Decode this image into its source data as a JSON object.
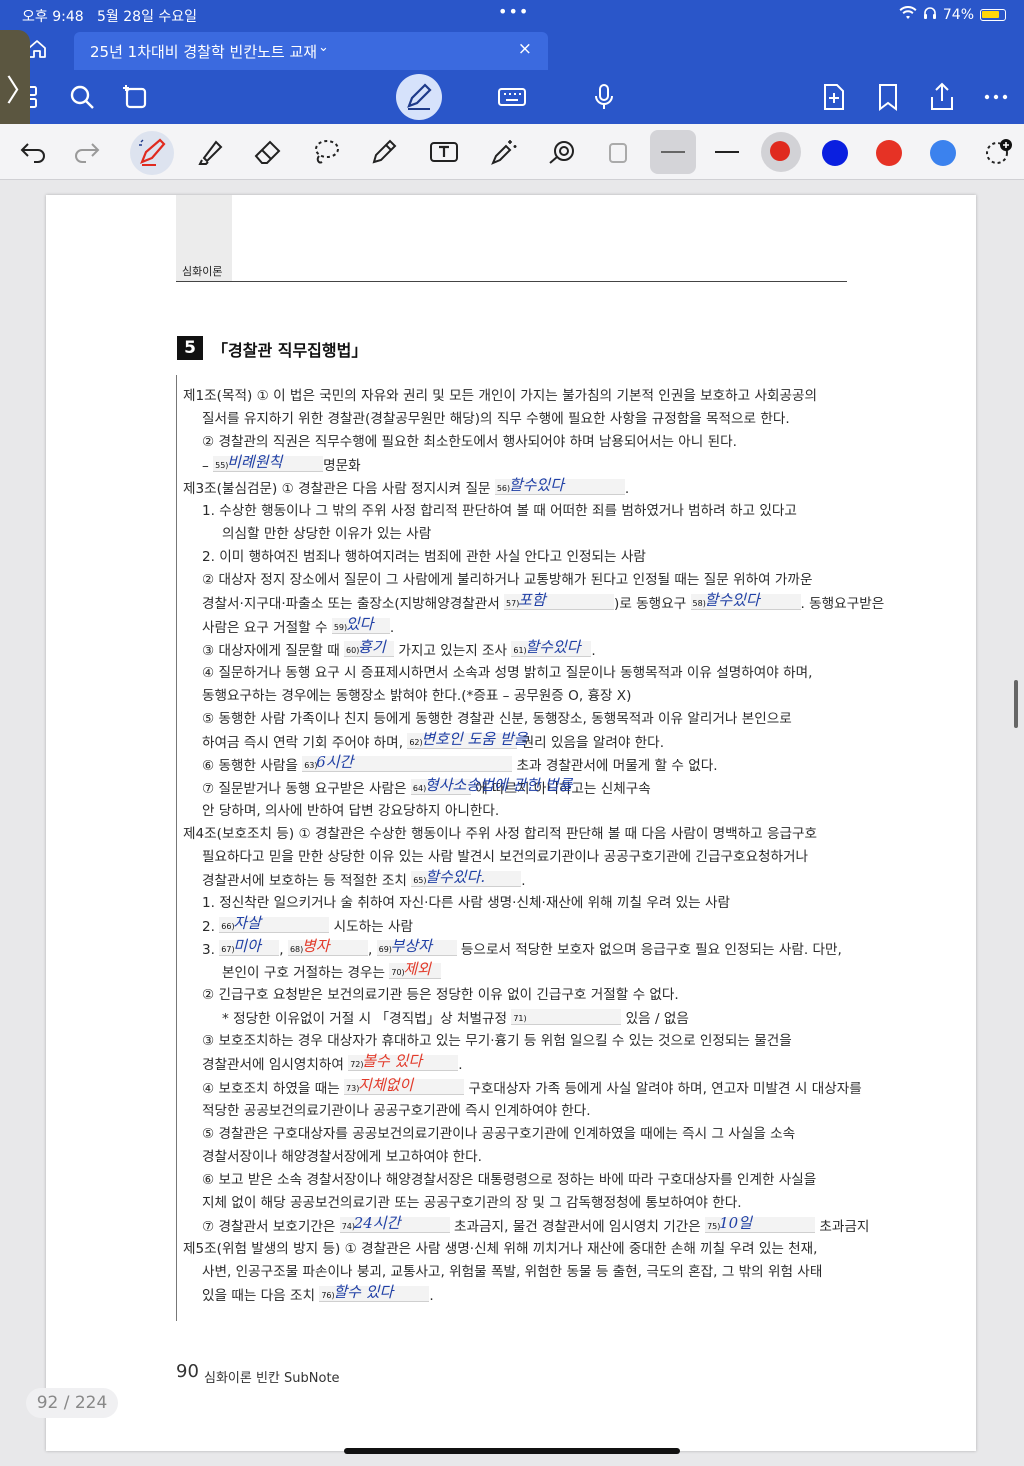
{
  "status": {
    "time": "오후 9:48",
    "date": "5월 28일 수요일",
    "battery": "74%"
  },
  "tab": {
    "title": "25년 1차대비 경찰학 빈칸노트 교재"
  },
  "colors": {
    "toolbar": "#2a56c9",
    "swatches": [
      "#e02a1e",
      "#0a1fe0",
      "#e63225",
      "#3b82ee"
    ]
  },
  "page": {
    "running_head": "심화이론",
    "section_number": "5",
    "section_title": "「경찰관 직무집행법」",
    "lines": [
      {
        "t": "제1조(목적) ① 이 법은 국민의 자유와 권리 및 모든 개인이 가지는 불가침의 기본적 인권을 보호하고 사회공공의"
      },
      {
        "t": "질서를 유지하기 위한 경찰관(경찰공무원만 해당)의 직무 수행에 필요한 사항을 규정함을 목적으로 한다."
      },
      {
        "t": "② 경찰관의 직권은 직무수행에 필요한 최소한도에서 행사되어야 하며 남용되어서는 아니 된다."
      },
      {
        "pre": "– ",
        "n": "55)",
        "hw": "비례원칙",
        "post": "명문화"
      },
      {
        "pre": "제3조(불심검문) ① 경찰관은 다음 사람 정지시켜 질문 ",
        "n": "56)",
        "hw": "할수있다",
        "post": "."
      },
      {
        "t": "1.  수상한 행동이나 그 밖의 주위 사정 합리적 판단하여 볼 때 어떠한 죄를 범하였거나 범하려 하고 있다고"
      },
      {
        "t": "의심할 만한 상당한 이유가 있는 사람"
      },
      {
        "t": "2.  이미 행하여진 범죄나 행하여지려는 범죄에 관한 사실 안다고 인정되는 사람"
      },
      {
        "t": "② 대상자 정지 장소에서 질문이 그 사람에게 불리하거나 교통방해가 된다고 인정될 때는 질문 위하여 가까운"
      },
      {
        "pre": "경찰서·지구대·파출소 또는 출장소(지방해양경찰관서 ",
        "n": "57)",
        "hw": "포함",
        "mid": ")로 동행요구 ",
        "n2": "58)",
        "hw2": "할수있다",
        "post": ". 동행요구받은"
      },
      {
        "pre": "사람은 요구 거절할 수 ",
        "n": "59)",
        "hw": "있다",
        "post": "."
      },
      {
        "pre": "③ 대상자에게 질문할 때 ",
        "n": "60)",
        "hw": "흉기",
        "mid": " 가지고 있는지 조사 ",
        "n2": "61)",
        "hw2": "할수있다",
        "post": "."
      },
      {
        "t": "④ 질문하거나 동행 요구 시 증표제시하면서 소속과 성명 밝히고 질문이나 동행목적과 이유 설명하여야 하며,"
      },
      {
        "t": "동행요구하는 경우에는 동행장소 밝혀야 한다.(*증표 – 공무원증 O, 흉장 X)"
      },
      {
        "t": "⑤ 동행한 사람 가족이나 친지 등에게 동행한 경찰관 신분, 동행장소, 동행목적과 이유 알리거나 본인으로"
      },
      {
        "pre": "하여금 즉시 연락 기회 주어야 하며, ",
        "n": "62)",
        "hw": "변호인 도움 받을",
        "post": " 권리 있음을 알려야 한다."
      },
      {
        "pre": "⑥ 동행한 사람을 ",
        "n": "63)",
        "hw": "6시간",
        "post": " 초과 경찰관서에 머물게 할 수 없다."
      },
      {
        "pre": "⑦ 질문받거나 동행 요구받은 사람은 ",
        "n": "64)",
        "hw": "형사소송법에 관한 법률",
        "post": " 에 따르지 아니하고는 신체구속"
      },
      {
        "t": "안 당하며, 의사에 반하여 답변 강요당하지 아니한다."
      },
      {
        "t": "제4조(보호조치 등) ① 경찰관은 수상한 행동이나 주위 사정 합리적 판단해 볼 때 다음 사람이 명백하고 응급구호"
      },
      {
        "t": "필요하다고 믿을 만한 상당한 이유 있는 사람 발견시 보건의료기관이나 공공구호기관에 긴급구호요청하거나"
      },
      {
        "pre": "경찰관서에 보호하는 등 적절한 조치 ",
        "n": "65)",
        "hw": "할수있다.",
        "post": "."
      },
      {
        "t": "1.  정신착란 일으키거나 술 취하여 자신·다른 사람 생명·신체·재산에 위해 끼칠 우려 있는 사람"
      },
      {
        "pre": "2.  ",
        "n": "66)",
        "hw": "자살",
        "post": " 시도하는 사람"
      },
      {
        "pre": "3.  ",
        "n": "67)",
        "hw": "미아",
        "mid": ", ",
        "n2": "68)",
        "hw2": "병자",
        "mid2": ", ",
        "n3": "69)",
        "hw3": "부상자",
        "post": " 등으로서 적당한 보호자 없으며 응급구호 필요 인정되는 사람. 다만,"
      },
      {
        "pre": "본인이 구호 거절하는 경우는 ",
        "n": "70)",
        "hw": "제외",
        "post": ""
      },
      {
        "t": "② 긴급구호 요청받은 보건의료기관 등은 정당한 이유 없이 긴급구호 거절할 수 없다."
      },
      {
        "pre": "* 정당한 이유없이 거절 시 「경직법」상 처벌규정 ",
        "n": "71)",
        "hw": "",
        "post": " 있음 / 없음"
      },
      {
        "t": "③ 보호조치하는 경우 대상자가 휴대하고 있는 무기·흉기 등 위험 일으킬 수 있는 것으로 인정되는 물건을"
      },
      {
        "pre": "경찰관서에 임시영치하여 ",
        "n": "72)",
        "hw": "볼수 있다",
        "post": "."
      },
      {
        "pre": "④ 보호조치 하였을 때는 ",
        "n": "73)",
        "hw": "지체없이",
        "post": " 구호대상자 가족 등에게 사실 알려야 하며, 연고자 미발견 시 대상자를"
      },
      {
        "t": "적당한 공공보건의료기관이나 공공구호기관에 즉시 인계하여야 한다."
      },
      {
        "t": "⑤ 경찰관은 구호대상자를 공공보건의료기관이나 공공구호기관에 인계하였을 때에는 즉시 그 사실을 소속"
      },
      {
        "t": "경찰서장이나 해양경찰서장에게 보고하여야 한다."
      },
      {
        "t": "⑥ 보고 받은 소속 경찰서장이나 해양경찰서장은 대통령령으로 정하는 바에 따라 구호대상자를 인계한 사실을"
      },
      {
        "t": "지체 없이 해당 공공보건의료기관 또는 공공구호기관의 장 및 그 감독행정청에 통보하여야 한다."
      },
      {
        "pre": "⑦ 경찰관서 보호기간은 ",
        "n": "74)",
        "hw": "24시간",
        "mid": " 초과금지, 물건 경찰관서에 임시영치 기간은 ",
        "n2": "75)",
        "hw2": "10일",
        "post": " 초과금지"
      },
      {
        "t": "제5조(위험 발생의 방지 등) ① 경찰관은 사람 생명·신체 위해 끼치거나 재산에 중대한 손해 끼칠 우려 있는 천재,"
      },
      {
        "t": "사변, 인공구조물 파손이나 붕괴, 교통사고, 위험물 폭발, 위험한 동물 등 출현, 극도의 혼잡, 그 밖의 위험 사태"
      },
      {
        "pre": "있을 때는 다음 조치 ",
        "n": "76)",
        "hw": "할수 있다",
        "post": "."
      }
    ],
    "footer_number": "90",
    "footer_text": "심화이론 빈칸 SubNote"
  },
  "page_indicator": "92 / 224"
}
